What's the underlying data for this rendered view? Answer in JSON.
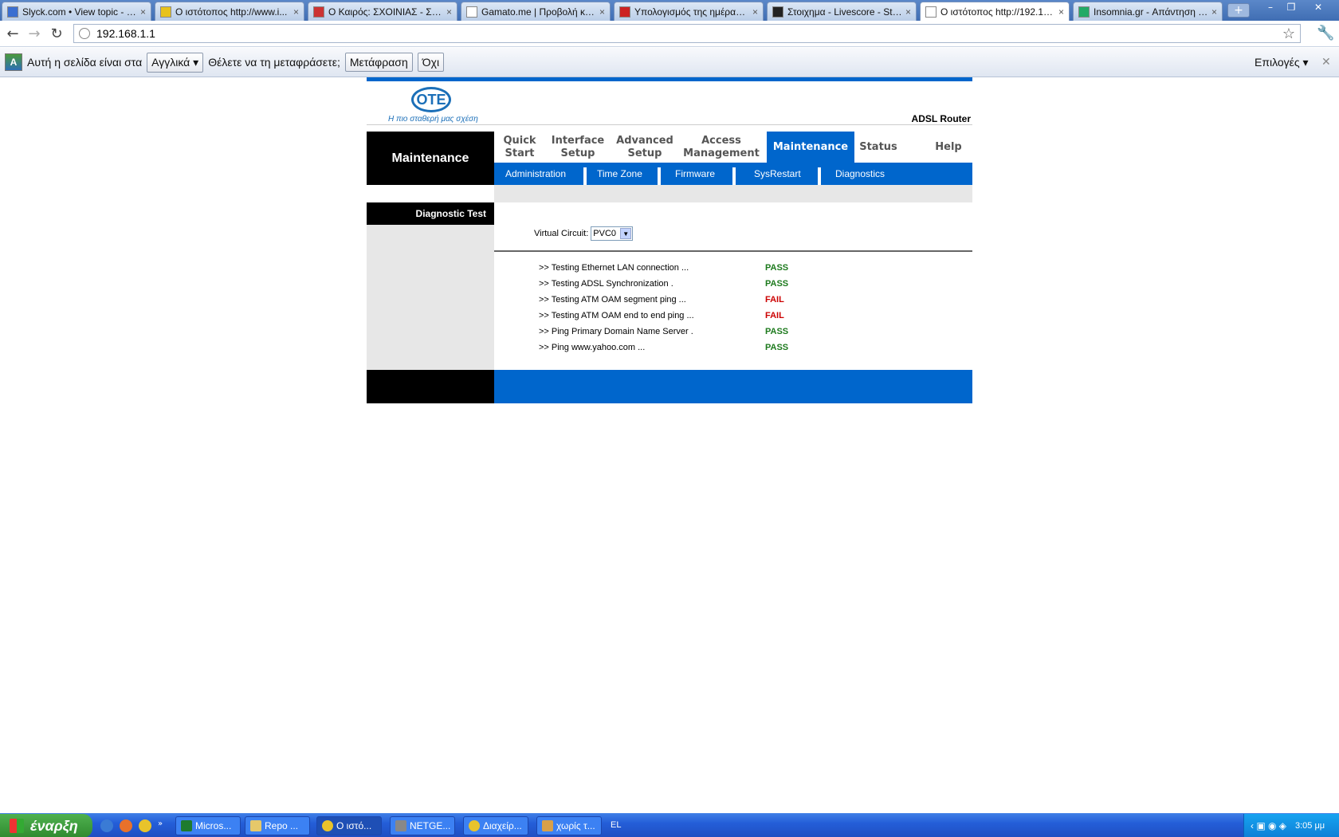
{
  "browser": {
    "tabs": [
      {
        "label": "Slyck.com • View topic - W...",
        "icon": "S",
        "active": false
      },
      {
        "label": "Ο ιστότοπος http://www.i...",
        "icon": "IMDb",
        "active": false
      },
      {
        "label": "Ο Καιρός: ΣΧΟΙΝΙΑΣ - ΣΧΟ...",
        "icon": "W",
        "active": false
      },
      {
        "label": "Gamato.me | Προβολή κατ...",
        "icon": "page",
        "active": false
      },
      {
        "label": "Υπολογισμός της ημέρας τ...",
        "icon": "flower",
        "active": false
      },
      {
        "label": "Στοιχημα - Livescore - Stoi...",
        "icon": "ball",
        "active": false
      },
      {
        "label": "Ο ιστότοπος http://192.16...",
        "icon": "page",
        "active": true
      },
      {
        "label": "Insomnia.gr - Απάντηση σ...",
        "icon": "eyes",
        "active": false
      }
    ],
    "new_tab": "+",
    "window_controls": {
      "minimize": "–",
      "restore": "❐",
      "close": "✕"
    },
    "nav": {
      "back": "←",
      "forward": "→",
      "reload": "↻"
    },
    "address": "192.168.1.1",
    "bookmark_icon": "☆",
    "menu_icon": "🔧"
  },
  "infobar": {
    "text_before": "Αυτή η σελίδα είναι στα",
    "language_value": "Αγγλικά ▾",
    "text_after": "Θέλετε να τη μεταφράσετε;",
    "translate_button": "Μετάφραση",
    "no_button": "Όχι",
    "options": "Επιλογές ▾",
    "close": "✕",
    "icon": "A"
  },
  "router": {
    "logo": "OTE",
    "slogan": "Η πιο σταθερή μας σχέση",
    "product": "ADSL Router",
    "section_title": "Maintenance",
    "main_nav": [
      {
        "label": "Quick\nStart",
        "active": false
      },
      {
        "label": "Interface\nSetup",
        "active": false
      },
      {
        "label": "Advanced\nSetup",
        "active": false
      },
      {
        "label": "Access\nManagement",
        "active": false
      },
      {
        "label": "Maintenance",
        "active": true
      },
      {
        "label": "Status",
        "active": false
      },
      {
        "label": "Help",
        "active": false
      }
    ],
    "sub_nav": [
      "Administration",
      "Time Zone",
      "Firmware",
      "SysRestart",
      "Diagnostics"
    ],
    "side_title": "Diagnostic Test",
    "virtual_circuit_label": "Virtual Circuit:",
    "virtual_circuit_value": "PVC0",
    "tests": [
      {
        "label": ">> Testing Ethernet LAN connection ...",
        "result": "PASS"
      },
      {
        "label": ">> Testing ADSL Synchronization .",
        "result": "PASS"
      },
      {
        "label": ">> Testing ATM OAM segment ping ...",
        "result": "FAIL"
      },
      {
        "label": ">> Testing ATM OAM end to end ping ...",
        "result": "FAIL"
      },
      {
        "label": ">> Ping Primary Domain Name Server .",
        "result": "PASS"
      },
      {
        "label": ">> Ping www.yahoo.com ...",
        "result": "PASS"
      }
    ],
    "colors": {
      "brand_blue": "#0066cc",
      "pass": "#1d7a1d",
      "fail": "#cc0000"
    }
  },
  "taskbar": {
    "start": "έναρξη",
    "buttons": [
      {
        "label": "Micros...",
        "active": false
      },
      {
        "label": "Repo ...",
        "active": false
      },
      {
        "label": "Ο ιστό...",
        "active": true
      },
      {
        "label": "NETGE...",
        "active": false
      },
      {
        "label": "Διαχείρ...",
        "active": false
      },
      {
        "label": "χωρίς τ...",
        "active": false
      }
    ],
    "language": "EL",
    "clock": "3:05 μμ"
  }
}
